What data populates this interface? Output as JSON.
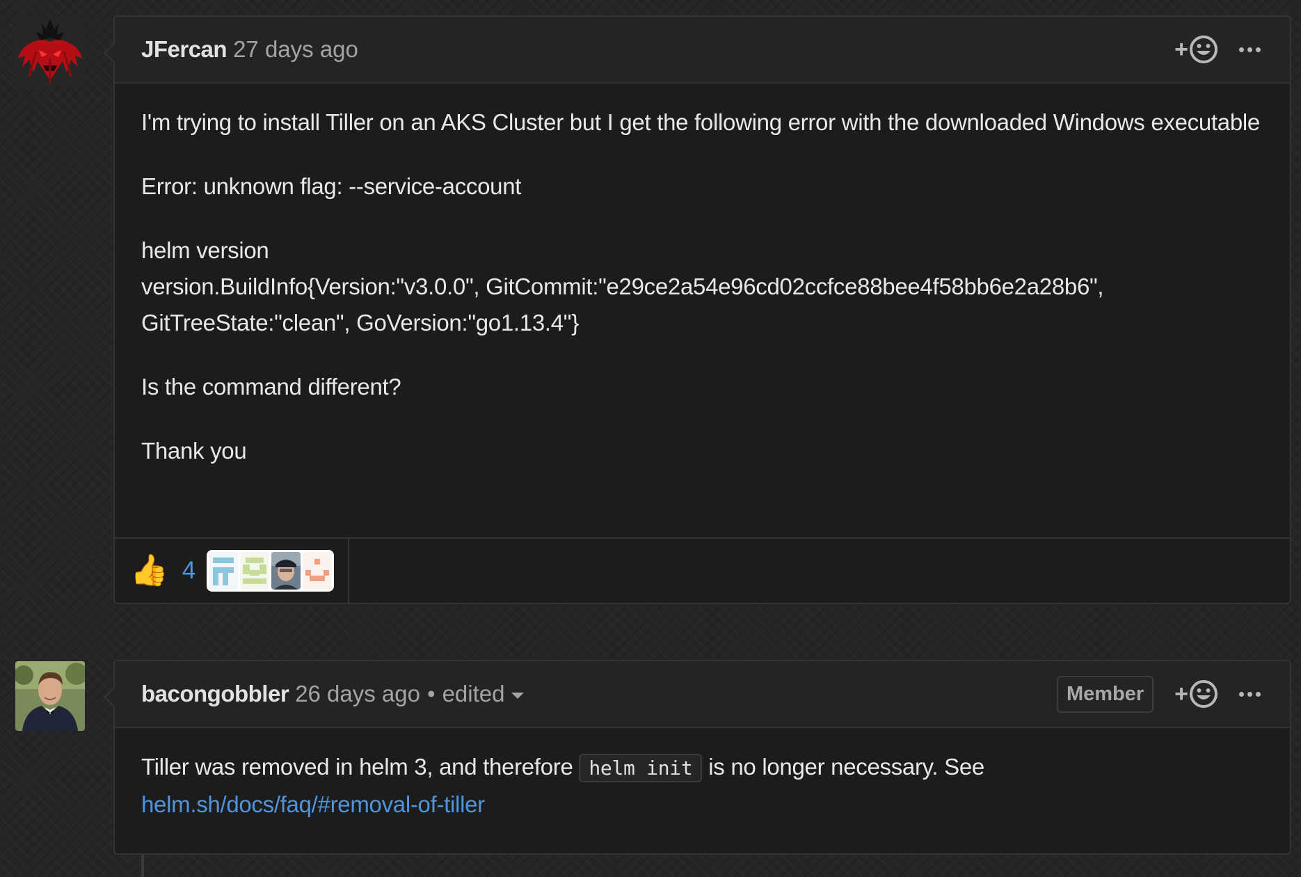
{
  "comments": [
    {
      "author": "JFercan",
      "timestamp": "27 days ago",
      "avatar_icon": "red-demon-avatar",
      "body": {
        "p1": "I'm trying to install Tiller on an AKS Cluster but I get the following error with the downloaded Windows executable",
        "p2": "Error: unknown flag: --service-account",
        "p3_line1": "helm version",
        "p3_line2": "version.BuildInfo{Version:\"v3.0.0\", GitCommit:\"e29ce2a54e96cd02ccfce88bee4f58bb6e2a28b6\", GitTreeState:\"clean\", GoVersion:\"go1.13.4\"}",
        "p4": "Is the command different?",
        "p5": "Thank you"
      },
      "reactions": [
        {
          "emoji": "👍",
          "count": "4",
          "reactor_icons": [
            "identicon-blue",
            "identicon-green",
            "user-photo",
            "identicon-orange"
          ]
        }
      ]
    },
    {
      "author": "bacongobbler",
      "timestamp": "26 days ago",
      "separator": "•",
      "edited_label": "edited",
      "badge": "Member",
      "avatar_icon": "user-photo-avatar",
      "body": {
        "text_before": "Tiller was removed in helm 3, and therefore ",
        "code": "helm init",
        "text_after": " is no longer necessary. See",
        "link": "helm.sh/docs/faq/#removal-of-tiller"
      }
    }
  ],
  "actions": {
    "add_reaction_plus": "+"
  }
}
